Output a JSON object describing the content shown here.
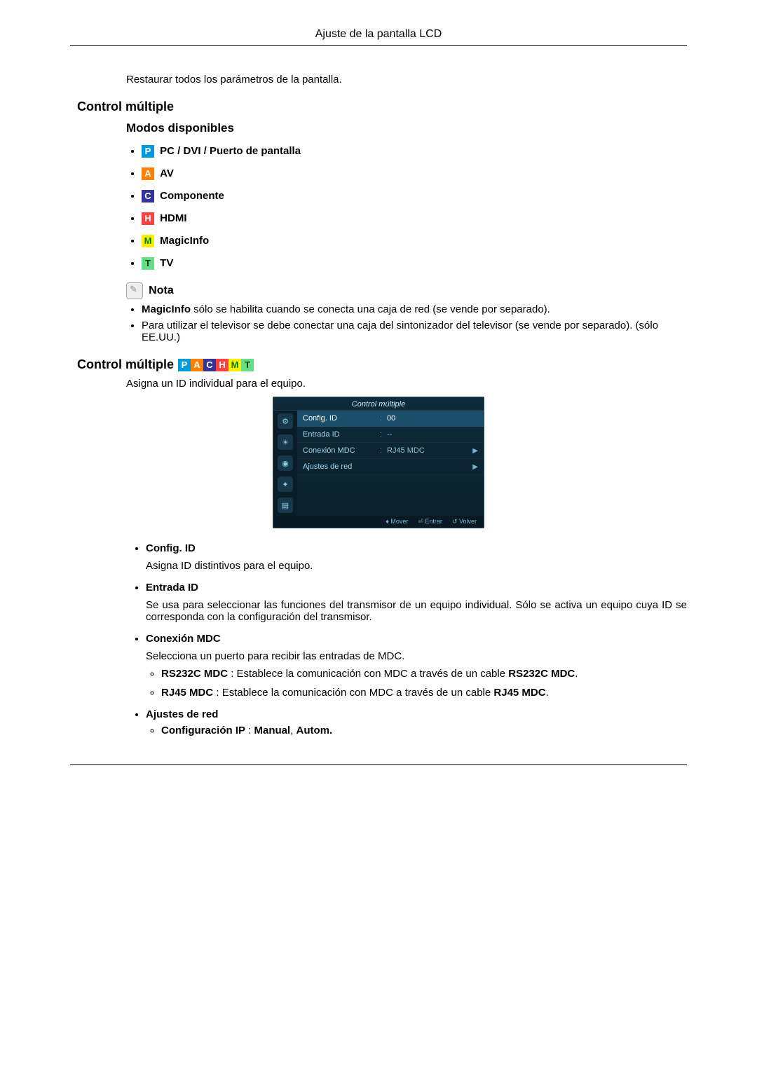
{
  "header": {
    "title": "Ajuste de la pantalla LCD"
  },
  "intro": {
    "text": "Restaurar todos los parámetros de la pantalla."
  },
  "section1": {
    "heading": "Control múltiple",
    "modes_heading": "Modos disponibles",
    "modes": [
      {
        "badge": "P",
        "label": " PC / DVI / Puerto de pantalla"
      },
      {
        "badge": "A",
        "label": " AV"
      },
      {
        "badge": "C",
        "label": " Componente"
      },
      {
        "badge": "H",
        "label": " HDMI"
      },
      {
        "badge": "M",
        "label": " MagicInfo"
      },
      {
        "badge": "T",
        "label": " TV"
      }
    ],
    "note_label": " Nota",
    "notes": [
      "MagicInfo sólo se habilita cuando se conecta una caja de red (se vende por separado).",
      "Para utilizar el televisor se debe conectar una caja del sintonizador del televisor (se vende por separado). (sólo EE.UU.)"
    ]
  },
  "section2": {
    "heading": "Control múltiple",
    "intro": "Asigna un ID individual para el equipo."
  },
  "osd": {
    "title": "Control múltiple",
    "rows": [
      {
        "label": "Config. ID",
        "value": "00",
        "selected": true,
        "arrow": false
      },
      {
        "label": "Entrada ID",
        "value": "--",
        "selected": false,
        "arrow": false
      },
      {
        "label": "Conexión MDC",
        "value": "RJ45 MDC",
        "selected": false,
        "arrow": true
      },
      {
        "label": "Ajustes de red",
        "value": "",
        "selected": false,
        "arrow": true
      }
    ],
    "footer": {
      "move": "Mover",
      "enter": "Entrar",
      "return": "Volver"
    }
  },
  "items": [
    {
      "title": "Config. ID",
      "desc": "Asigna ID distintivos para el equipo."
    },
    {
      "title": "Entrada ID",
      "desc": "Se usa para seleccionar las funciones del transmisor de un equipo individual. Sólo se activa un equipo cuya ID se corresponda con la configuración del transmisor."
    },
    {
      "title": "Conexión MDC",
      "desc": "Selecciona un puerto para recibir las entradas de MDC.",
      "sub": [
        {
          "bold1": "RS232C MDC",
          "text": " : Establece la comunicación con MDC a través de un cable ",
          "bold2": "RS232C MDC",
          "tail": "."
        },
        {
          "bold1": "RJ45 MDC",
          "text": " : Establece la comunicación con MDC a través de un cable ",
          "bold2": "RJ45 MDC",
          "tail": "."
        }
      ]
    },
    {
      "title": "Ajustes de red",
      "sub2": {
        "bold": "Configuración IP",
        "text": " : ",
        "v1": "Manual",
        "sep": ", ",
        "v2": "Autom."
      }
    }
  ]
}
